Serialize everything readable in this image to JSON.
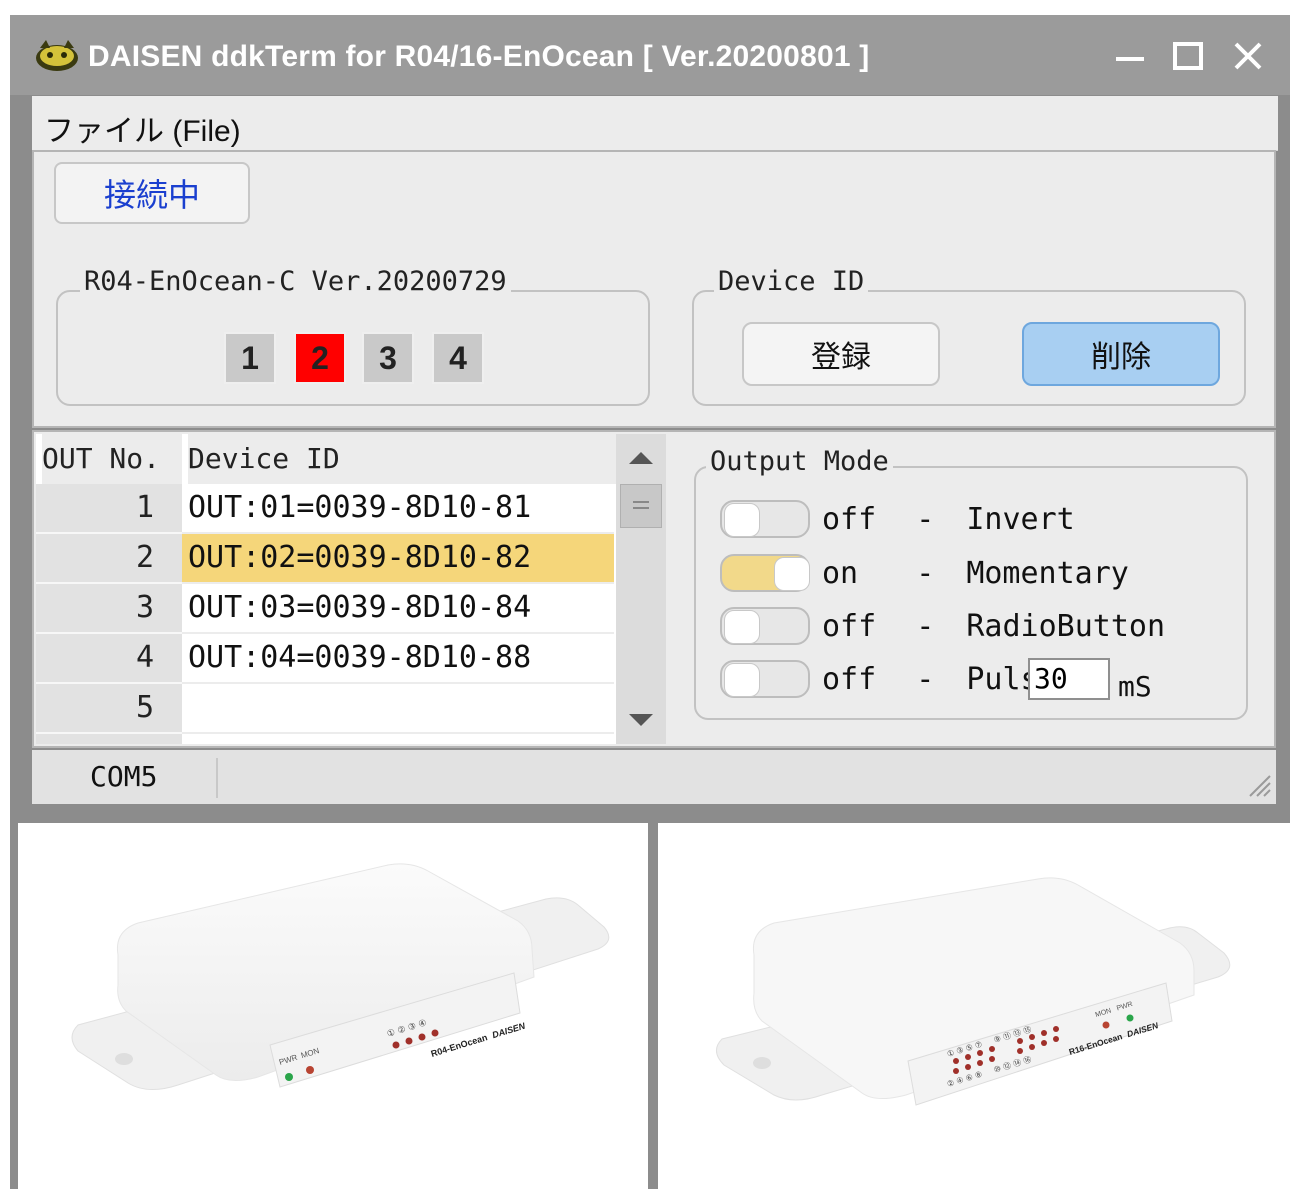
{
  "window": {
    "title": "DAISEN ddkTerm for R04/16-EnOcean [ Ver.20200801 ]",
    "controls": {
      "minimize": "minimize-icon",
      "maximize": "maximize-icon",
      "close": "close-icon"
    }
  },
  "menu": {
    "file_label": "ファイル (File)"
  },
  "connection": {
    "button_label": "接続中"
  },
  "board_group": {
    "legend": "R04-EnOcean-C Ver.20200729",
    "channels": [
      "1",
      "2",
      "3",
      "4"
    ],
    "active_channel": "2"
  },
  "device_group": {
    "legend": "Device ID",
    "register_label": "登録",
    "delete_label": "削除"
  },
  "grid": {
    "headers": [
      "OUT No.",
      "Device ID"
    ],
    "rows": [
      {
        "no": "1",
        "device": "OUT:01=0039-8D10-81"
      },
      {
        "no": "2",
        "device": "OUT:02=0039-8D10-82"
      },
      {
        "no": "3",
        "device": "OUT:03=0039-8D10-84"
      },
      {
        "no": "4",
        "device": "OUT:04=0039-8D10-88"
      },
      {
        "no": "5",
        "device": ""
      }
    ],
    "selected_row": 2
  },
  "output_mode": {
    "legend": "Output Mode",
    "modes": [
      {
        "state": "off",
        "sep": "-",
        "name": "Invert",
        "on": false
      },
      {
        "state": "on",
        "sep": "-",
        "name": "Momentary",
        "on": true
      },
      {
        "state": "off",
        "sep": "-",
        "name": "RadioButton",
        "on": false
      },
      {
        "state": "off",
        "sep": "-",
        "name": "Pulse",
        "on": false
      }
    ],
    "pulse_value": "30",
    "pulse_unit": "mS"
  },
  "status": {
    "port": "COM5"
  },
  "devices": {
    "r04": {
      "leds": [
        "①",
        "②",
        "③",
        "④"
      ],
      "pwr": "PWR",
      "mon": "MON",
      "model": "R04-EnOcean",
      "brand": "DAISEN"
    },
    "r16": {
      "leds_top": [
        "①",
        "③",
        "⑤",
        "⑦",
        "⑨",
        "⑪",
        "⑬",
        "⑮"
      ],
      "leds_bottom": [
        "②",
        "④",
        "⑥",
        "⑧",
        "⑩",
        "⑫",
        "⑭",
        "⑯"
      ],
      "pwr": "PWR",
      "mon": "MON",
      "model": "R16-EnOcean",
      "brand": "DAISEN"
    }
  },
  "colors": {
    "active_channel": "#ff0000",
    "selection": "#f5d67a",
    "connect_text": "#1a3fcf",
    "delete_button": "#a8cff2"
  }
}
